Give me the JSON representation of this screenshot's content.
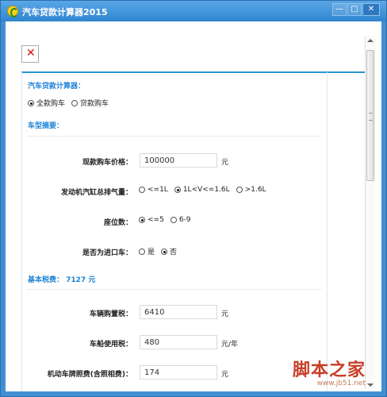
{
  "window": {
    "title": "汽车贷款计算器2015",
    "buttons": [
      "—",
      "□",
      "✕"
    ]
  },
  "broken_icon": "✕",
  "calculator": {
    "header": "汽车贷款计算器：",
    "purchase_options": [
      {
        "label": "全款购车",
        "checked": true
      },
      {
        "label": "贷款购车",
        "checked": false
      }
    ]
  },
  "car_summary": {
    "header": "车型摘要："
  },
  "rows": {
    "price": {
      "label": "现款购车价格：",
      "value": "100000",
      "unit": "元"
    },
    "displacement": {
      "label": "发动机汽缸总排气量：",
      "options": [
        {
          "label": "<=1L",
          "checked": false
        },
        {
          "label": "1L<V<=1.6L",
          "checked": true
        },
        {
          "label": ">1.6L",
          "checked": false
        }
      ]
    },
    "seats": {
      "label": "座位数：",
      "options": [
        {
          "label": "<=5",
          "checked": true
        },
        {
          "label": "6-9",
          "checked": false
        }
      ]
    },
    "imported": {
      "label": "是否为进口车：",
      "options": [
        {
          "label": "是",
          "checked": false
        },
        {
          "label": "否",
          "checked": true
        }
      ]
    },
    "purchase_tax": {
      "label": "车辆购置税：",
      "value": "6410",
      "unit": "元"
    },
    "vehicle_tax": {
      "label": "车船使用税：",
      "value": "480",
      "unit": "元/年"
    },
    "registration_fee": {
      "label": "机动车牌照费(含照相费)：",
      "value": "174",
      "unit": "元"
    }
  },
  "tax": {
    "header": "基本税费： 7127 元"
  },
  "watermark": {
    "title": "脚本之家",
    "site": "www.jb51.net"
  }
}
